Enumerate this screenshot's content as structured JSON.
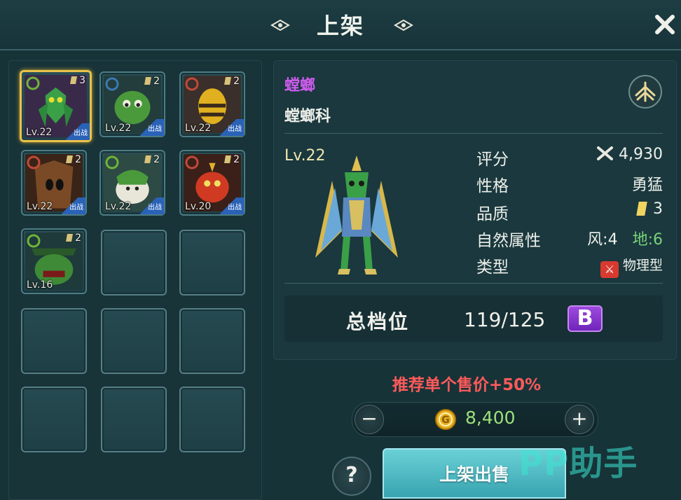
{
  "header": {
    "title": "上架",
    "close_label": "✕"
  },
  "inventory": {
    "slots": [
      {
        "level": "Lv.22",
        "quality": "3",
        "tag": "出战",
        "selected": true
      },
      {
        "level": "Lv.22",
        "quality": "2",
        "tag": "出战",
        "selected": false
      },
      {
        "level": "Lv.22",
        "quality": "2",
        "tag": "出战",
        "selected": false
      },
      {
        "level": "Lv.22",
        "quality": "2",
        "tag": "出战",
        "selected": false
      },
      {
        "level": "Lv.22",
        "quality": "2",
        "tag": "出战",
        "selected": false
      },
      {
        "level": "Lv.20",
        "quality": "2",
        "tag": "出战",
        "selected": false
      },
      {
        "level": "Lv.16",
        "quality": "2",
        "tag": "",
        "selected": false
      }
    ]
  },
  "pet": {
    "name": "螳螂",
    "family": "螳螂科",
    "level": "Lv.22",
    "stats": {
      "score_label": "评分",
      "score_value": "4,930",
      "nature_label": "性格",
      "nature_value": "勇猛",
      "quality_label": "品质",
      "quality_value": "3",
      "attribute_label": "自然属性",
      "attr_wind": "风:4",
      "attr_earth": "地:6",
      "type_label": "类型",
      "type_value": "物理型"
    },
    "grade": {
      "label": "总档位",
      "value": "119/125",
      "badge": "B"
    }
  },
  "price": {
    "recommend": "推荐单个售价+50%",
    "amount": "8,400",
    "minus": "−",
    "plus": "+"
  },
  "actions": {
    "help": "?",
    "sell": "上架出售"
  },
  "watermark": "PP助手",
  "colors": {
    "accent_name": "#d05cf0",
    "price_green": "#9fe07a",
    "recommend_red": "#ff5a5a",
    "grade_purple": "#8a3cd0",
    "earth_green": "#7ad27a"
  }
}
